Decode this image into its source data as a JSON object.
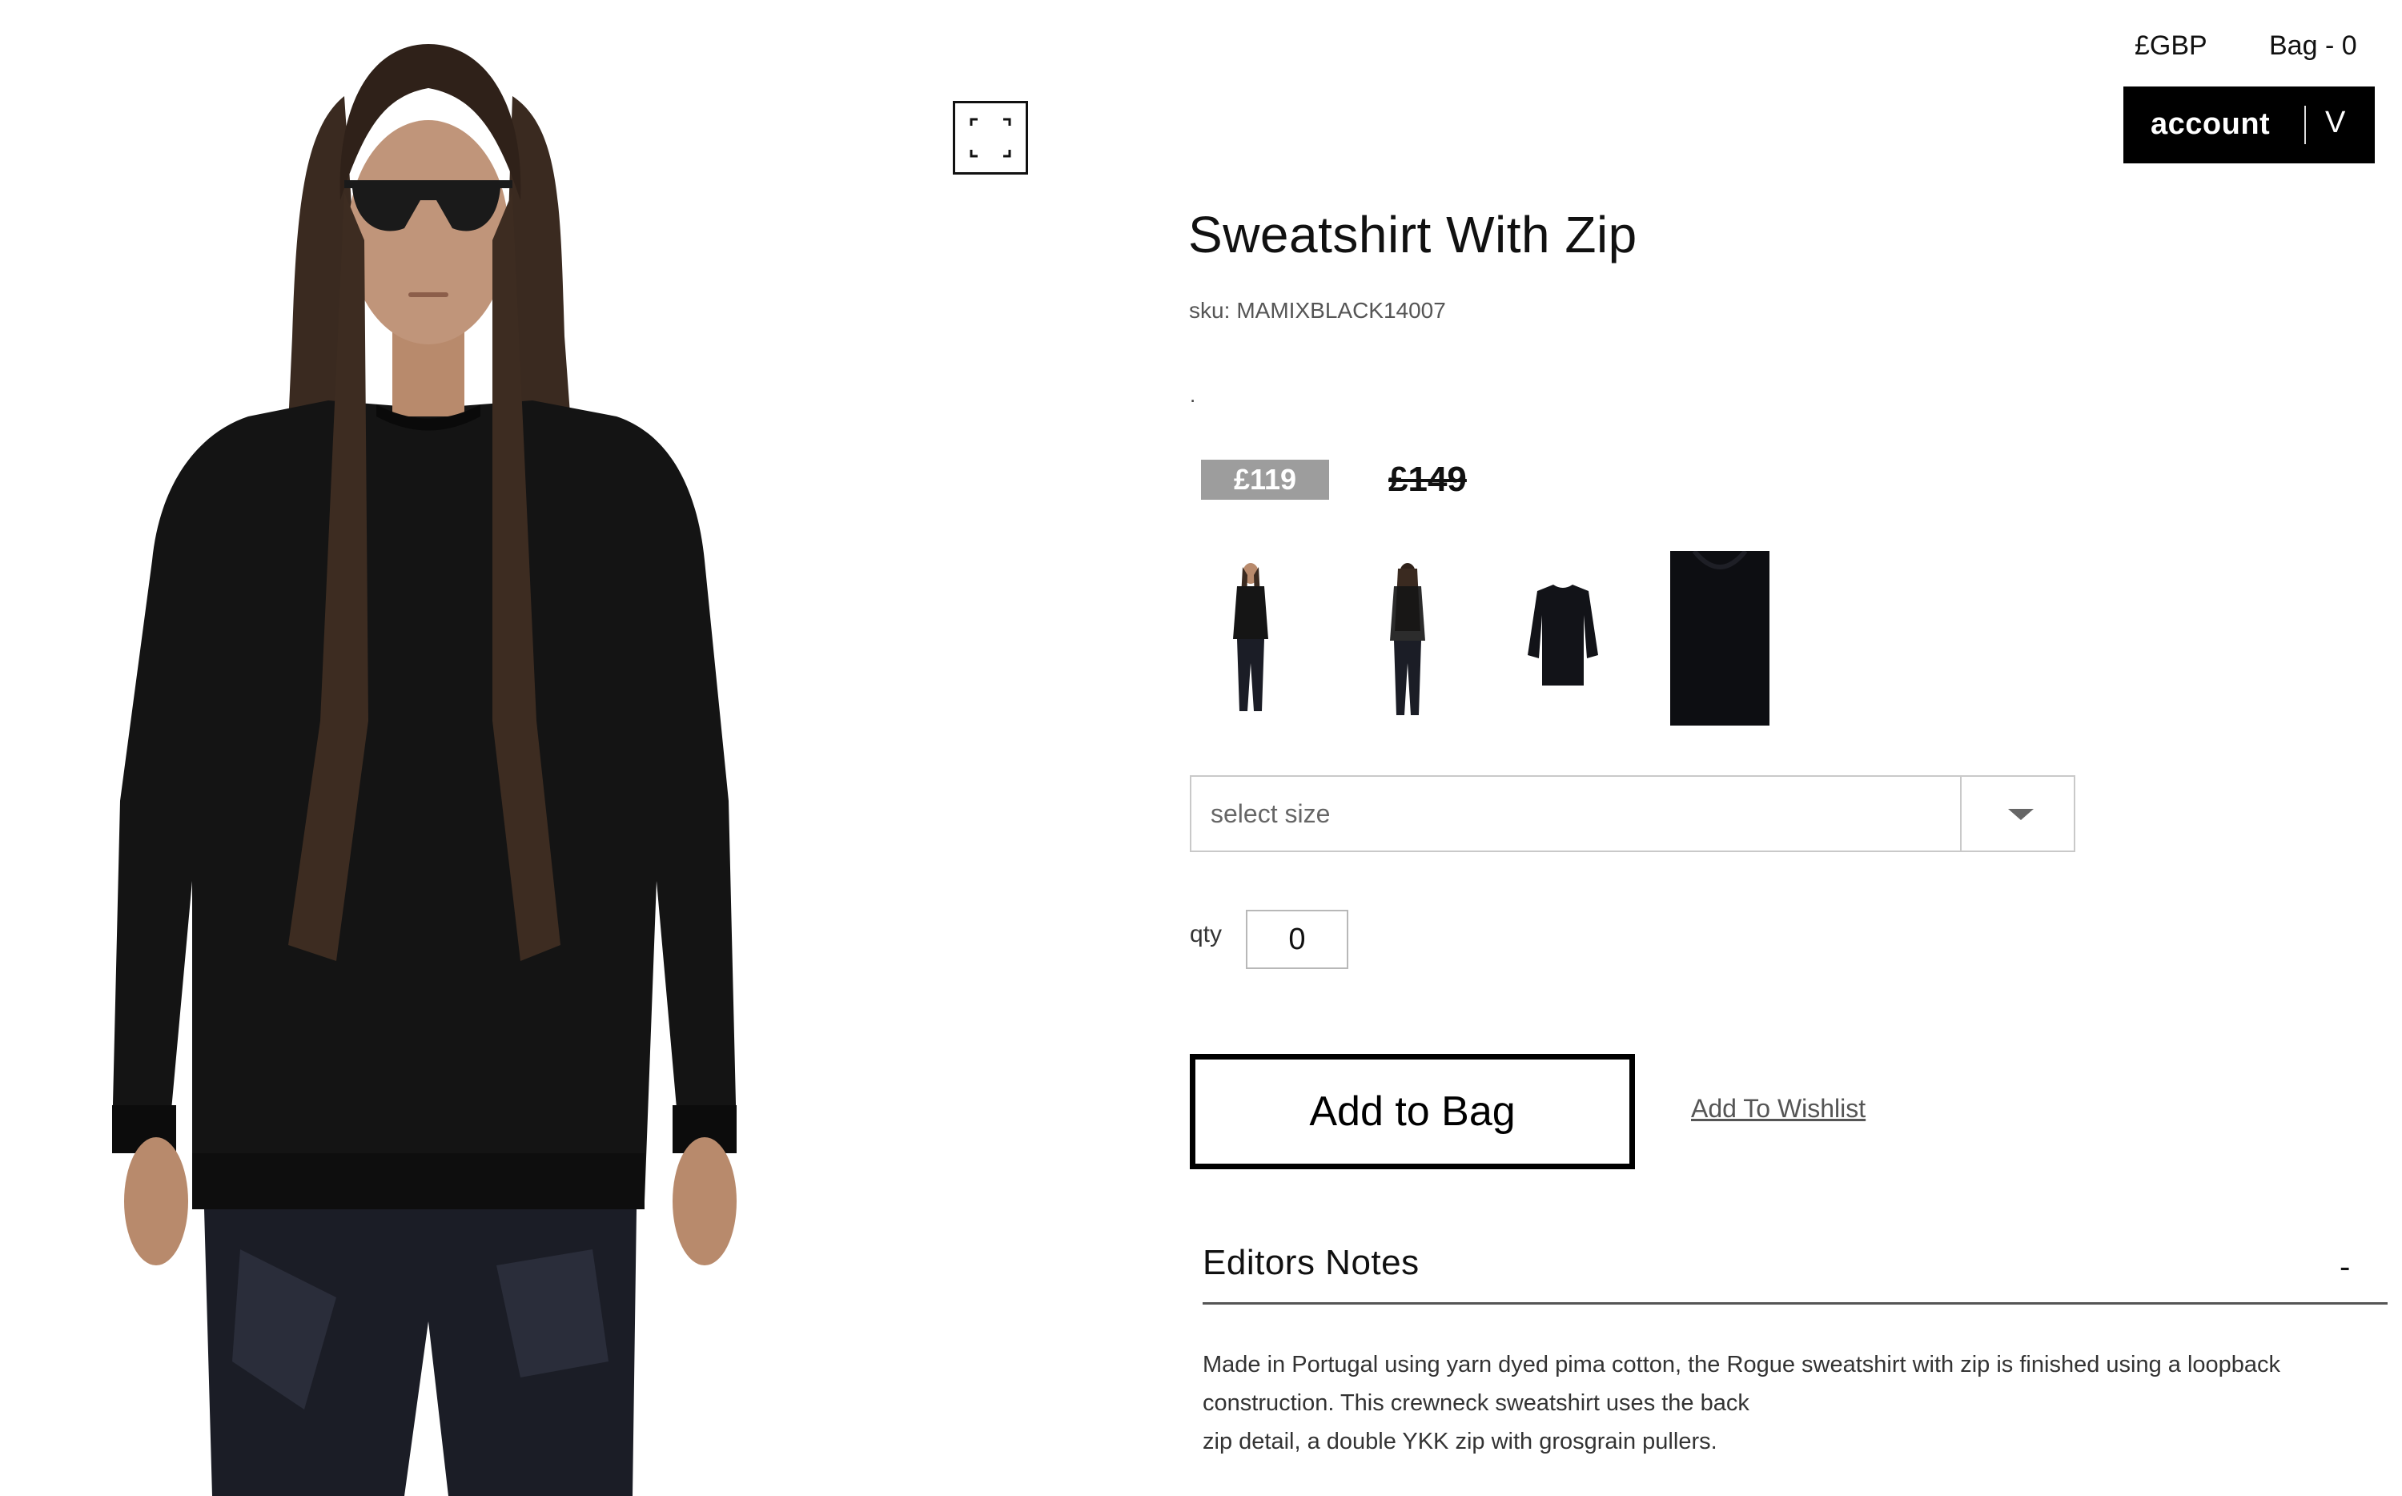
{
  "header": {
    "currency": "£GBP",
    "bag": "Bag - 0",
    "account_label": "account",
    "account_chevron": "V"
  },
  "product": {
    "title": "Sweatshirt With Zip",
    "sku_label": "sku:",
    "sku": "MAMIXBLACK14007",
    "dot": ".",
    "price_sale": "£119",
    "price_original": "£149"
  },
  "thumbnails": [
    {
      "name": "front-full-body"
    },
    {
      "name": "back-full-body"
    },
    {
      "name": "flat-lay"
    },
    {
      "name": "fabric-closeup"
    }
  ],
  "size_select": {
    "placeholder": "select size"
  },
  "quantity": {
    "label": "qty",
    "value": "0"
  },
  "actions": {
    "add_to_bag": "Add to Bag",
    "add_to_wishlist": "Add To Wishlist"
  },
  "editors_notes": {
    "title": "Editors Notes",
    "toggle": "-",
    "lines": [
      "Made in Portugal using yarn dyed pima cotton, the Rogue sweatshirt with zip is finished using a loopback",
      "construction. This crewneck sweatshirt uses the back",
      "zip detail, a double YKK zip with grosgrain pullers."
    ]
  },
  "icons": {
    "zoom": "expand-icon",
    "dropdown": "caret-down-icon"
  },
  "colors": {
    "sale_badge": "#9d9d9d",
    "account_bg": "#000000",
    "text": "#111111"
  }
}
